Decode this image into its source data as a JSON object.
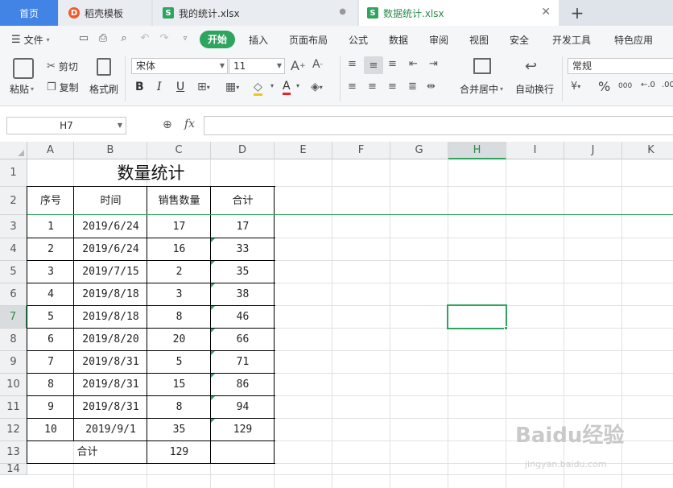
{
  "tabs": {
    "home": "首页",
    "docer": "稻壳模板",
    "mystats": "我的统计.xlsx",
    "datastats": "数据统计.xlsx",
    "add_icon": "plus-icon"
  },
  "menu": {
    "file": "文件",
    "start": "开始",
    "insert": "插入",
    "layout": "页面布局",
    "formula": "公式",
    "data": "数据",
    "review": "审阅",
    "view": "视图",
    "security": "安全",
    "developer": "开发工具",
    "special": "特色应用"
  },
  "ribbon": {
    "paste": "粘贴",
    "cut": "剪切",
    "copy": "复制",
    "format_painter": "格式刷",
    "font_name": "宋体",
    "font_size": "11",
    "merge_center": "合并居中",
    "wrap_text": "自动换行",
    "number_format": "常规",
    "percent": "%",
    "thousands": "000"
  },
  "formula_bar": {
    "cell_ref": "H7",
    "fx": "fx",
    "value": ""
  },
  "sheet": {
    "columns": [
      "A",
      "B",
      "C",
      "D",
      "E",
      "F",
      "G",
      "H",
      "I",
      "J",
      "K"
    ],
    "rows": [
      "1",
      "2",
      "3",
      "4",
      "5",
      "6",
      "7",
      "8",
      "9",
      "10",
      "11",
      "12",
      "13",
      "14"
    ],
    "selected_col": "H",
    "selected_row": "7",
    "title": "数量统计",
    "headers": [
      "序号",
      "时间",
      "销售数量",
      "合计"
    ],
    "records": [
      [
        "1",
        "2019/6/24",
        "17",
        "17"
      ],
      [
        "2",
        "2019/6/24",
        "16",
        "33"
      ],
      [
        "3",
        "2019/7/15",
        "2",
        "35"
      ],
      [
        "4",
        "2019/8/18",
        "3",
        "38"
      ],
      [
        "5",
        "2019/8/18",
        "8",
        "46"
      ],
      [
        "6",
        "2019/8/20",
        "20",
        "66"
      ],
      [
        "7",
        "2019/8/31",
        "5",
        "71"
      ],
      [
        "8",
        "2019/8/31",
        "15",
        "86"
      ],
      [
        "9",
        "2019/8/31",
        "8",
        "94"
      ],
      [
        "10",
        "2019/9/1",
        "35",
        "129"
      ]
    ],
    "total_label": "合计",
    "total_value": "129"
  },
  "watermark": {
    "main": "Baidu经验",
    "sub": "jingyan.baidu.com"
  },
  "colors": {
    "accent_green": "#2ea55f",
    "home_tab_blue": "#4283e6"
  }
}
